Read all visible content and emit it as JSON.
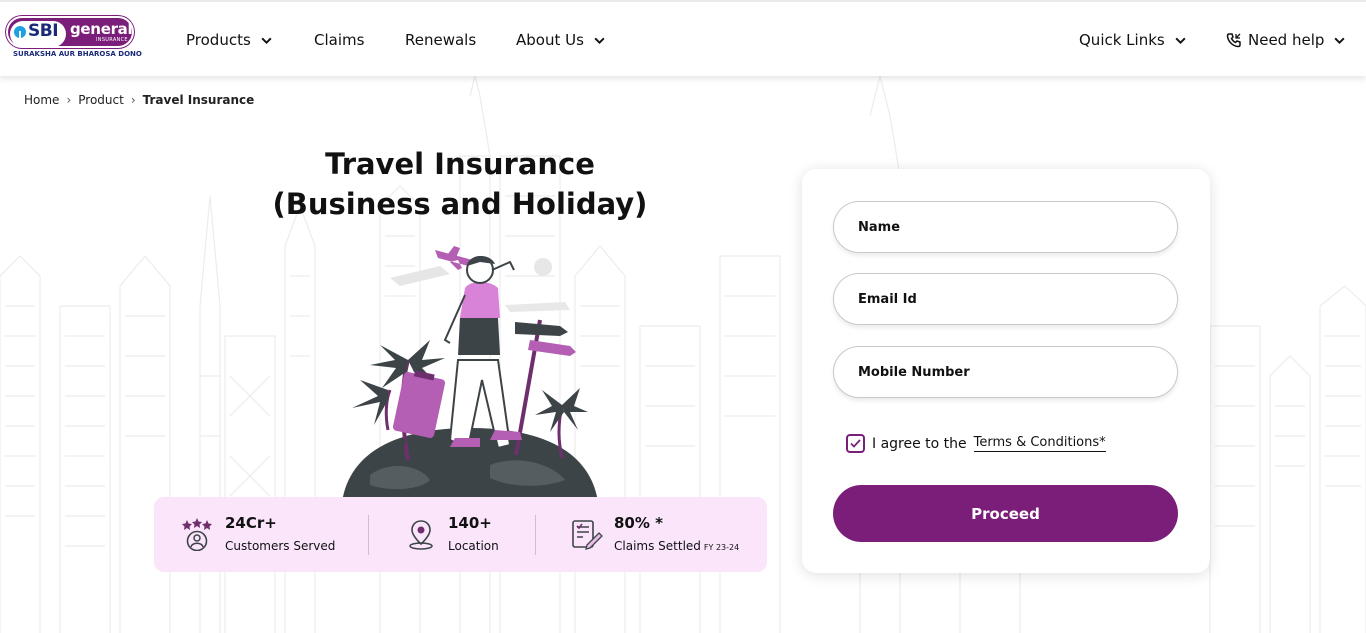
{
  "brand": {
    "logo_text_1": "SBI",
    "logo_text_2": "general",
    "logo_text_3": "INSURANCE",
    "tagline": "SURAKSHA AUR BHAROSA DONO",
    "accent_color": "#7b1e7a"
  },
  "nav": {
    "items": [
      {
        "label": "Products",
        "has_dropdown": true
      },
      {
        "label": "Claims",
        "has_dropdown": false
      },
      {
        "label": "Renewals",
        "has_dropdown": false
      },
      {
        "label": "About Us",
        "has_dropdown": true
      }
    ],
    "quick_links": "Quick Links",
    "need_help": "Need help"
  },
  "breadcrumb": {
    "items": [
      "Home",
      "Product",
      "Travel Insurance"
    ]
  },
  "hero": {
    "title_line_1": "Travel Insurance",
    "title_line_2": "(Business and Holiday)"
  },
  "stats": [
    {
      "value": "24Cr+",
      "label": "Customers Served",
      "icon": "stars-user-icon"
    },
    {
      "value": "140+",
      "label": "Location",
      "icon": "location-pin-icon"
    },
    {
      "value": "80% *",
      "label": "Claims Settled",
      "sub": "FY 23-24",
      "icon": "claim-document-icon"
    }
  ],
  "form": {
    "name_placeholder": "Name",
    "email_placeholder": "Email Id",
    "mobile_placeholder": "Mobile Number",
    "agree_text": "I agree to the",
    "terms_link": "Terms & Conditions*",
    "agree_checked": true,
    "proceed_label": "Proceed"
  }
}
